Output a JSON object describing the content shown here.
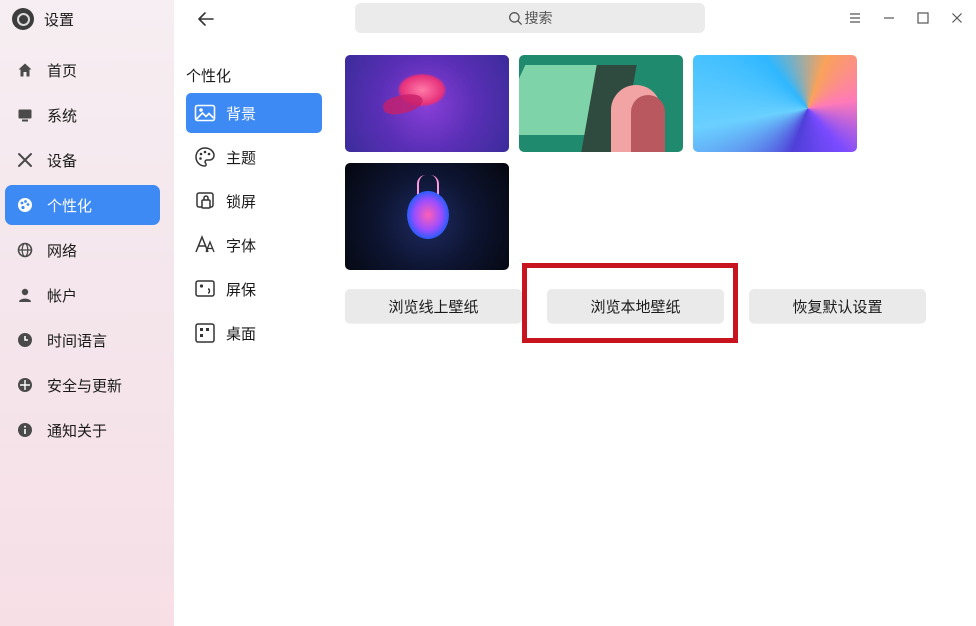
{
  "app": {
    "title": "设置",
    "icon": "gear-icon"
  },
  "search": {
    "placeholder": "搜索"
  },
  "sidebar": {
    "items": [
      {
        "label": "首页",
        "icon": "home-icon",
        "active": false
      },
      {
        "label": "系统",
        "icon": "monitor-icon",
        "active": false
      },
      {
        "label": "设备",
        "icon": "tools-icon",
        "active": false
      },
      {
        "label": "个性化",
        "icon": "palette-icon",
        "active": true
      },
      {
        "label": "网络",
        "icon": "globe-icon",
        "active": false
      },
      {
        "label": "帐户",
        "icon": "user-icon",
        "active": false
      },
      {
        "label": "时间语言",
        "icon": "clock-icon",
        "active": false
      },
      {
        "label": "安全与更新",
        "icon": "shield-icon",
        "active": false
      },
      {
        "label": "通知关于",
        "icon": "info-icon",
        "active": false
      }
    ]
  },
  "section": {
    "title": "个性化"
  },
  "subnav": {
    "items": [
      {
        "label": "背景",
        "icon": "image-icon",
        "active": true
      },
      {
        "label": "主题",
        "icon": "theme-palette-icon",
        "active": false
      },
      {
        "label": "锁屏",
        "icon": "lockscreen-icon",
        "active": false
      },
      {
        "label": "字体",
        "icon": "font-icon",
        "active": false
      },
      {
        "label": "屏保",
        "icon": "screensaver-icon",
        "active": false
      },
      {
        "label": "桌面",
        "icon": "desktop-grid-icon",
        "active": false
      }
    ]
  },
  "buttons": {
    "online": "浏览线上壁纸",
    "local": "浏览本地壁纸",
    "reset": "恢复默认设置"
  },
  "colors": {
    "accent": "#3d8af5",
    "highlight": "#c8141e"
  }
}
